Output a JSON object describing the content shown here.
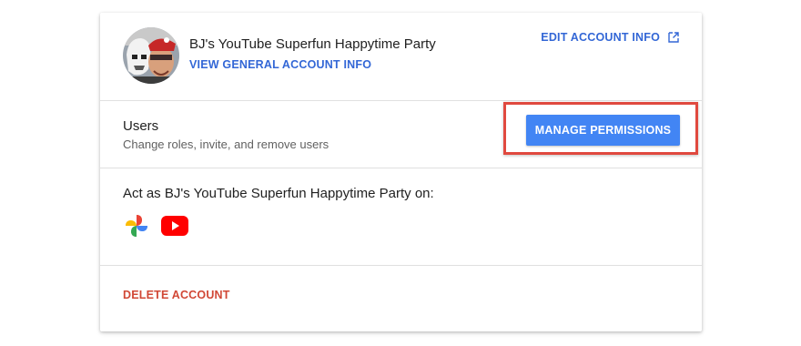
{
  "header": {
    "account_name": "BJ's YouTube Superfun Happytime Party",
    "view_general_label": "VIEW GENERAL ACCOUNT INFO",
    "edit_account_label": "EDIT ACCOUNT INFO",
    "avatar_icon": "profile-avatar",
    "edit_icon": "open-in-new-icon"
  },
  "users": {
    "title": "Users",
    "subtitle": "Change roles, invite, and remove users",
    "manage_label": "MANAGE PERMISSIONS"
  },
  "act_as": {
    "title": "Act as BJ's YouTube Superfun Happytime Party on:",
    "apps": [
      {
        "name": "google-photos-icon"
      },
      {
        "name": "youtube-icon"
      }
    ]
  },
  "delete": {
    "label": "DELETE ACCOUNT"
  },
  "colors": {
    "link_blue": "#3367d6",
    "button_blue": "#4285f4",
    "delete_red": "#d14836",
    "highlight_red": "#e0493f"
  }
}
